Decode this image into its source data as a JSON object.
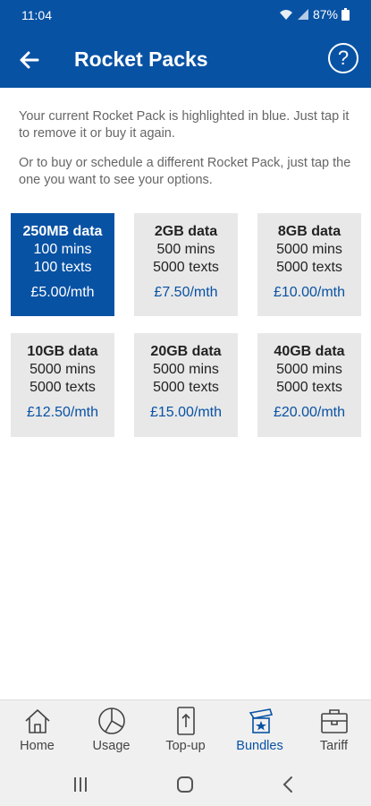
{
  "status_bar": {
    "time": "11:04",
    "battery": "87%"
  },
  "header": {
    "title": "Rocket Packs",
    "help": "?"
  },
  "intro": {
    "line1": "Your current Rocket Pack is highlighted in blue. Just tap it to remove it or buy it again.",
    "line2": "Or to buy or schedule a different Rocket Pack, just tap the one you want to see your options."
  },
  "packs": [
    {
      "data": "250MB data",
      "mins": "100 mins",
      "texts": "100 texts",
      "price": "£5.00/mth",
      "current": true
    },
    {
      "data": "2GB data",
      "mins": "500 mins",
      "texts": "5000 texts",
      "price": "£7.50/mth",
      "current": false
    },
    {
      "data": "8GB data",
      "mins": "5000 mins",
      "texts": "5000 texts",
      "price": "£10.00/mth",
      "current": false
    },
    {
      "data": "10GB data",
      "mins": "5000 mins",
      "texts": "5000 texts",
      "price": "£12.50/mth",
      "current": false
    },
    {
      "data": "20GB data",
      "mins": "5000 mins",
      "texts": "5000 texts",
      "price": "£15.00/mth",
      "current": false
    },
    {
      "data": "40GB data",
      "mins": "5000 mins",
      "texts": "5000 texts",
      "price": "£20.00/mth",
      "current": false
    }
  ],
  "nav": [
    {
      "label": "Home",
      "icon": "home-icon",
      "active": false
    },
    {
      "label": "Usage",
      "icon": "pie-chart-icon",
      "active": false
    },
    {
      "label": "Top-up",
      "icon": "top-up-phone-icon",
      "active": false
    },
    {
      "label": "Bundles",
      "icon": "bundles-icon",
      "active": true
    },
    {
      "label": "Tariff",
      "icon": "briefcase-icon",
      "active": false
    }
  ],
  "colors": {
    "brand": "#0852a4",
    "card": "#e8e8e8",
    "nav_bg": "#f0f0f0"
  }
}
